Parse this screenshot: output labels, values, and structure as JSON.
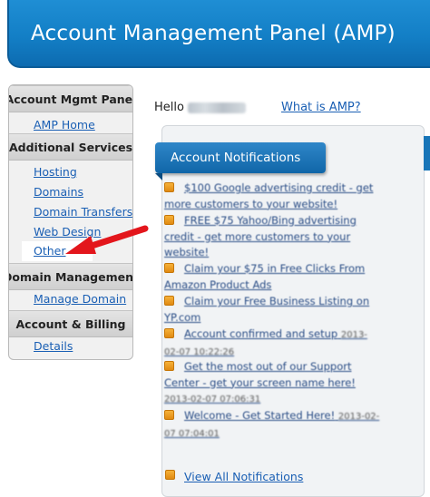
{
  "header": {
    "title": "Account Management Panel (AMP)"
  },
  "sidebar": {
    "sections": [
      {
        "heading": "Account Mgmt Panel",
        "items": [
          "AMP Home"
        ]
      },
      {
        "heading": "Additional Services",
        "items": [
          "Hosting",
          "Domains",
          "Domain Transfers",
          "Web Design",
          "Other"
        ]
      },
      {
        "heading": "Domain Management",
        "items": [
          "Manage Domain"
        ]
      },
      {
        "heading": "Account & Billing",
        "items": [
          "Details"
        ]
      }
    ]
  },
  "greeting": {
    "hello": "Hello",
    "what_is_link": "What is AMP?"
  },
  "notifications": {
    "title": "Account Notifications",
    "items": [
      {
        "text": "$100 Google advertising credit - get more customers to your website!",
        "date": ""
      },
      {
        "text": "FREE $75 Yahoo/Bing advertising credit - get more customers to your website!",
        "date": ""
      },
      {
        "text": "Claim your $75 in Free Clicks From Amazon Product Ads",
        "date": ""
      },
      {
        "text": "Claim your Free Business Listing on YP.com",
        "date": ""
      },
      {
        "text": "Account confirmed and setup",
        "date": "2013-02-07 10:22:26"
      },
      {
        "text": "Get the most out of our Support Center - get your screen name here!",
        "date": "2013-02-07 07:06:31"
      },
      {
        "text": "Welcome - Get Started Here!",
        "date": "2013-02-07 07:04:01"
      }
    ],
    "view_all": "View All Notifications"
  },
  "colors": {
    "banner": "#137fc6",
    "link": "#1a5fb4",
    "arrow": "#e3161c",
    "notif_icon": "#e08a12"
  }
}
